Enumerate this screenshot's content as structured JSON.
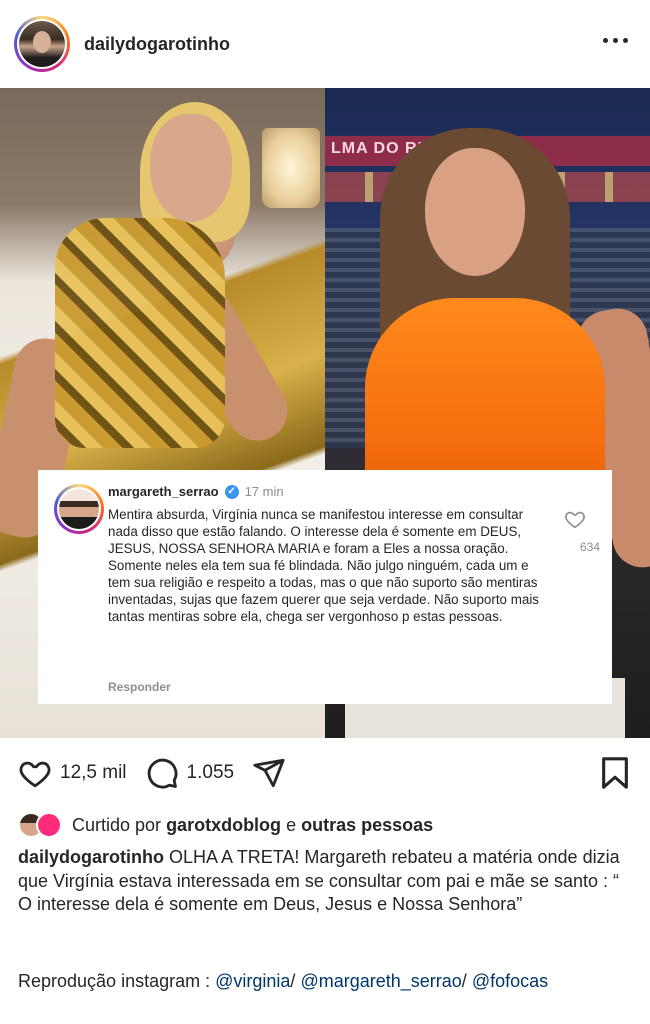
{
  "header": {
    "username": "dailydogarotinho",
    "more_icon": "more-horizontal-icon"
  },
  "post": {
    "stadium_text": "LMA DO RIO ESTÁ AC",
    "comment": {
      "username": "margareth_serrao",
      "time": "17 min",
      "text": "Mentira absurda, Virgínia nunca se manifestou interesse em consultar nada disso que estão falando. O interesse dela é somente em DEUS, JESUS, NOSSA SENHORA MARIA  e foram a Eles a nossa oração. Somente neles ela tem sua fé blindada. Não julgo ninguém, cada um e tem sua religião e respeito a todas, mas o que não suporto são mentiras inventadas, sujas que fazem querer que seja verdade. Não suporto mais tantas mentiras sobre ela, chega ser vergonhoso p estas pessoas.",
      "reply_label": "Responder",
      "like_count": "634"
    }
  },
  "actions": {
    "likes": "12,5 mil",
    "comments": "1.055"
  },
  "liked_by": {
    "prefix": "Curtido por",
    "user": "garotxdoblog",
    "conjunction": "e",
    "others": "outras pessoas"
  },
  "caption": {
    "username": "dailydogarotinho",
    "text": "OLHA A TRETA! Margareth rebateu a matéria onde dizia que Virgínia estava interessada em se consultar com pai e mãe se santo : “ O interesse dela é somente em Deus, Jesus e Nossa Senhora”",
    "reproducao_prefix": "Reprodução instagram :",
    "mention1": "@virginia",
    "sep1": "/",
    "mention2": "@margareth_serrao",
    "sep2": "/",
    "mention3": "@fofocas"
  }
}
